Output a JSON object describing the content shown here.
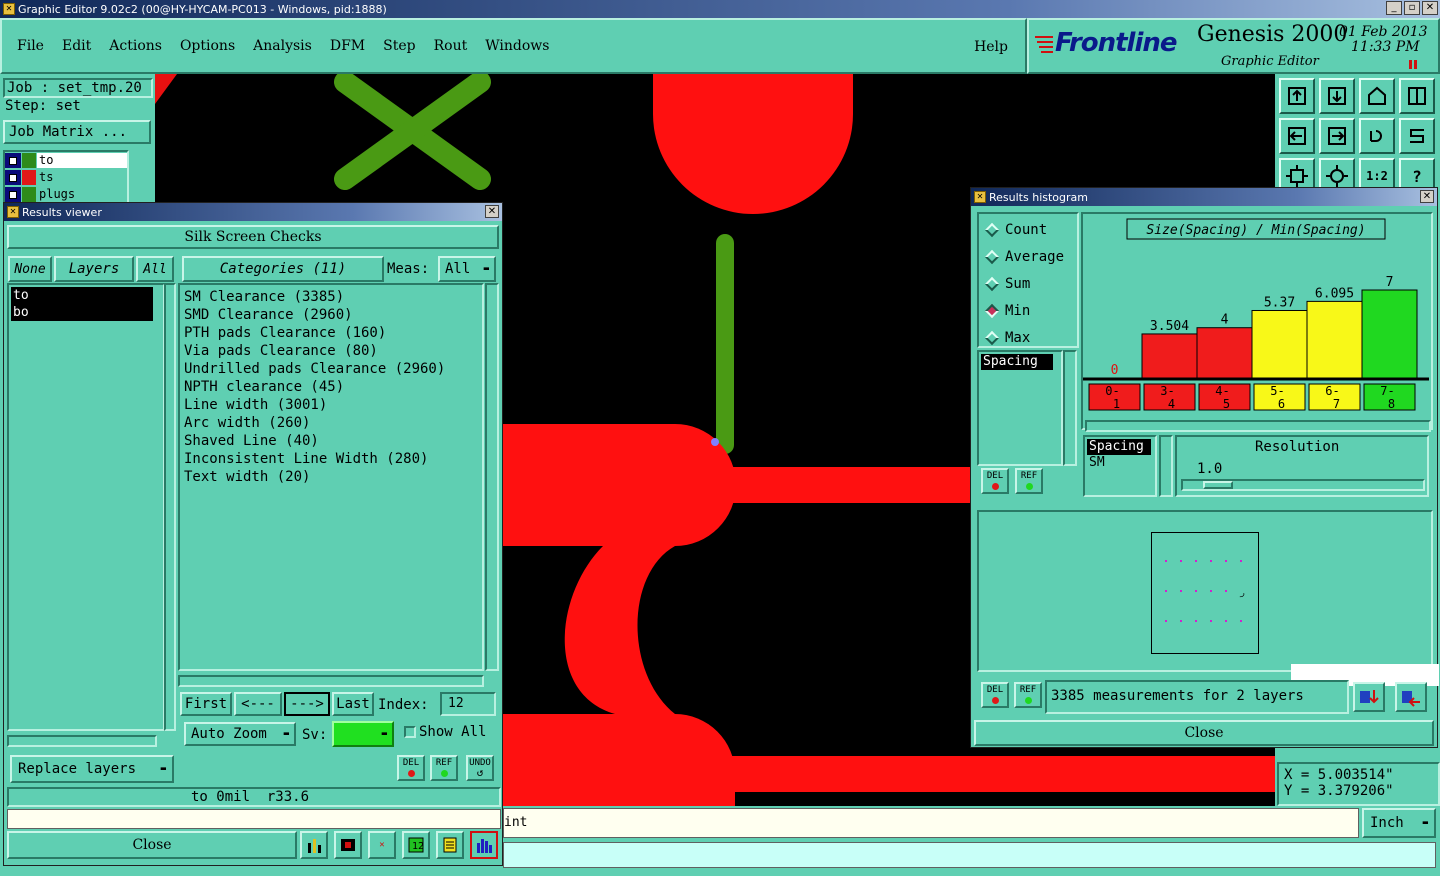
{
  "window": {
    "title": "Graphic Editor 9.02c2 (00@HY-HYCAM-PC013 - Windows, pid:1888)"
  },
  "menu": [
    "File",
    "Edit",
    "Actions",
    "Options",
    "Analysis",
    "DFM",
    "Step",
    "Rout",
    "Windows"
  ],
  "help_label": "Help",
  "brand": {
    "logo": "Frontline",
    "product": "Genesis 2000",
    "subtitle": "Graphic Editor",
    "date": "01 Feb 2013",
    "time": "11:33 PM"
  },
  "job": {
    "job_line": "Job : set_tmp.20",
    "step_line": "Step: set",
    "matrix_button": "Job Matrix ..."
  },
  "layer_list": [
    {
      "name": "to",
      "color": "#2e8b1a"
    },
    {
      "name": "ts",
      "color": "#e01818"
    },
    {
      "name": "plugs",
      "color": "#2e8b1a"
    }
  ],
  "results_viewer": {
    "title": "Results viewer",
    "header": "Silk Screen Checks",
    "none_btn": "None",
    "layers_btn": "Layers",
    "all_btn": "All",
    "categories_label": "Categories (11)",
    "meas_label": "Meas:",
    "meas_value": "All",
    "layers": [
      "to",
      "bo"
    ],
    "categories": [
      "SM Clearance (3385)",
      "SMD Clearance (2960)",
      "PTH pads Clearance (160)",
      "Via pads Clearance (80)",
      "Undrilled pads Clearance (2960)",
      "NPTH clearance (45)",
      "Line width (3001)",
      "Arc width (260)",
      "Shaved Line (40)",
      "Inconsistent Line Width (280)",
      "Text width (20)"
    ],
    "first_btn": "First",
    "prev_btn": "<---",
    "next_btn": "--->",
    "last_btn": "Last",
    "index_label": "Index:",
    "index_value": "12",
    "auto_zoom": "Auto Zoom",
    "sv_label": "Sv:",
    "show_all": "Show All",
    "replace_layers": "Replace layers",
    "del_label": "DEL",
    "ref_label": "REF",
    "undo_label": "UNDO",
    "status": "to 0mil  r33.6",
    "close_btn": "Close"
  },
  "command_line": {
    "text": "int",
    "unit": "Inch"
  },
  "coordinates": {
    "x": "X = 5.003514\"",
    "y": "Y = 3.379206\""
  },
  "histogram": {
    "title": "Results histogram",
    "modes": [
      "Count",
      "Average",
      "Sum",
      "Min",
      "Max"
    ],
    "selected_mode": "Min",
    "chart_title": "Size(Spacing) / Min(Spacing)",
    "measure_list": [
      "Spacing"
    ],
    "layer_list": [
      "Spacing",
      "SM"
    ],
    "resolution_label": "Resolution",
    "resolution_value": "1.0",
    "summary": "3385 measurements for 2 layers",
    "close_btn": "Close",
    "del_label": "DEL",
    "ref_label": "REF",
    "colors": {
      "red": "#f01c1c",
      "yellow": "#f8f818",
      "green": "#20d820"
    }
  },
  "chart_data": {
    "type": "bar",
    "title": "Size(Spacing) / Min(Spacing)",
    "categories": [
      "0-1",
      "3-4",
      "4-5",
      "5-6",
      "6-7",
      "7-8"
    ],
    "values": [
      0,
      3.504,
      4,
      5.37,
      6.095,
      7
    ],
    "value_labels": [
      "0",
      "3.504",
      "4",
      "5.37",
      "6.095",
      "7"
    ],
    "bar_colors": [
      "#f01c1c",
      "#f01c1c",
      "#f01c1c",
      "#f8f818",
      "#f8f818",
      "#20d820"
    ],
    "ylim": [
      0,
      7
    ],
    "grid": false,
    "legend": "none"
  }
}
